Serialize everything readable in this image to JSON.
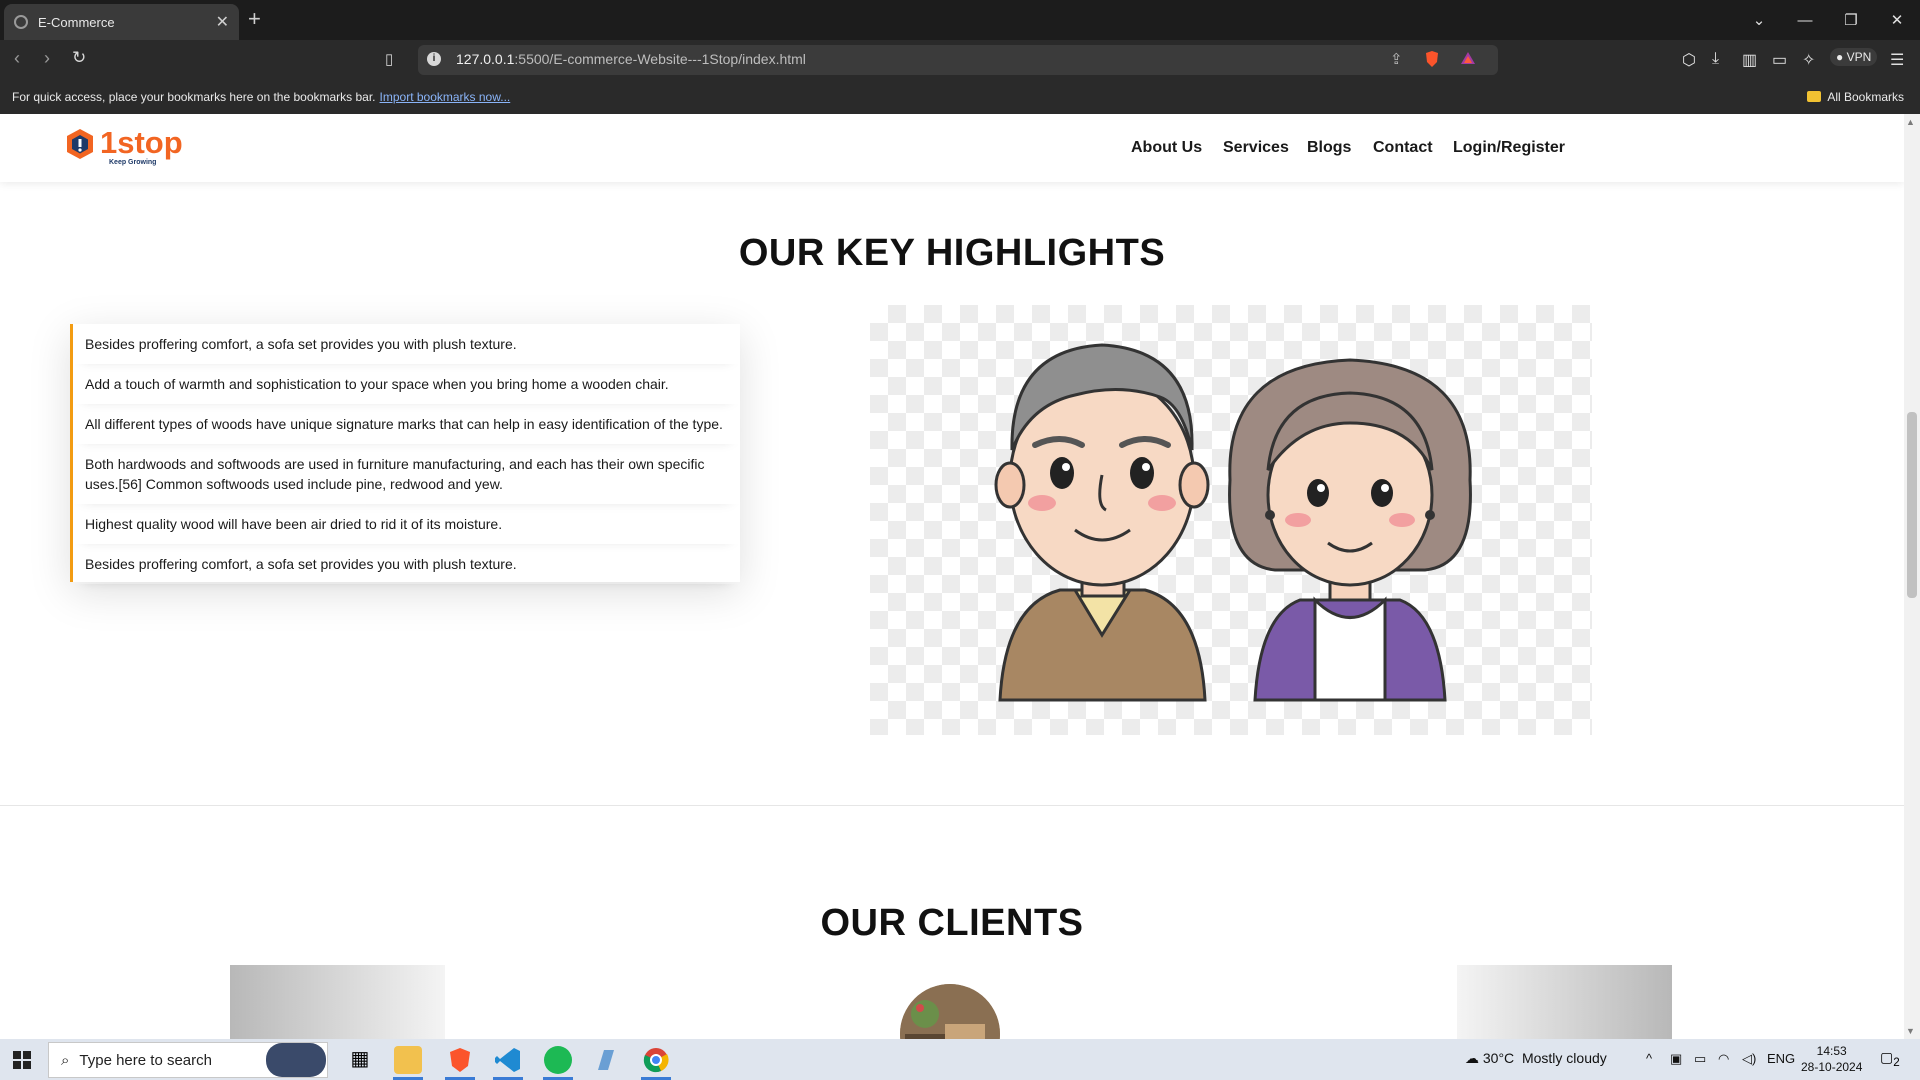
{
  "browser": {
    "tab_title": "E-Commerce",
    "tab_close": "✕",
    "new_tab": "+",
    "url_host": "127.0.0.1",
    "url_path": ":5500/E-commerce-Website---1Stop/index.html",
    "vpn_label": "VPN",
    "bookmarks_text": "For quick access, place your bookmarks here on the bookmarks bar.",
    "bookmarks_link": "Import bookmarks now...",
    "all_bookmarks": "All Bookmarks"
  },
  "site": {
    "logo_text": "1stop",
    "logo_tagline": "Keep Growing",
    "nav": [
      "About Us",
      "Services",
      "Blogs",
      "Contact",
      "Login/Register"
    ]
  },
  "highlights": {
    "title": "OUR KEY HIGHLIGHTS",
    "items": [
      "Besides proffering comfort, a sofa set provides you with plush texture.",
      "Add a touch of warmth and sophistication to your space when you bring home a wooden chair.",
      "All different types of woods have unique signature marks that can help in easy identification of the type.",
      "Both hardwoods and softwoods are used in furniture manufacturing, and each has their own specific uses.[56] Common softwoods used include pine, redwood and yew.",
      "Highest quality wood will have been air dried to rid it of its moisture.",
      "Besides proffering comfort, a sofa set provides you with plush texture."
    ]
  },
  "clients": {
    "title": "OUR CLIENTS"
  },
  "taskbar": {
    "search_placeholder": "Type here to search",
    "temperature": "30°C",
    "weather": "Mostly cloudy",
    "lang": "ENG",
    "time": "14:53",
    "date": "28-10-2024",
    "notif_count": "2"
  },
  "colors": {
    "accent": "#f39c12",
    "logo_orange": "#f26522",
    "logo_navy": "#1f3a68"
  }
}
